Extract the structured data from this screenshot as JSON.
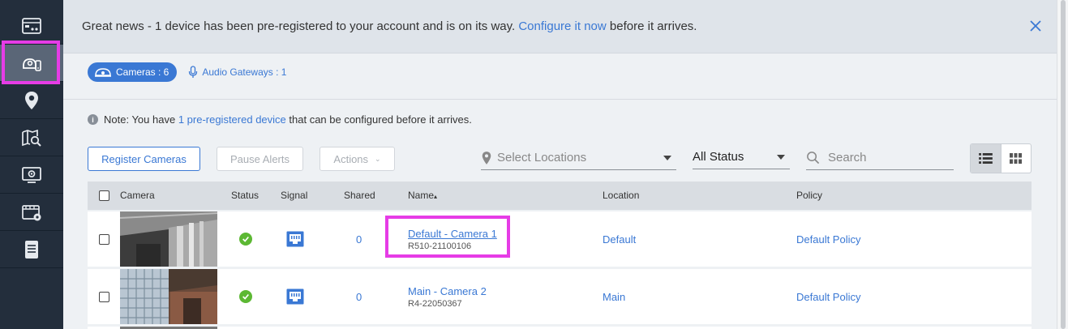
{
  "banner": {
    "text_before": "Great news - 1 device has been pre-registered to your account and is on its way. ",
    "link": "Configure it now",
    "text_after": " before it arrives."
  },
  "tabs": {
    "cameras": "Cameras : 6",
    "audio": "Audio Gateways : 1"
  },
  "note": {
    "prefix": "Note: You have ",
    "link": "1 pre-registered device",
    "suffix": " that can be configured before it arrives."
  },
  "toolbar": {
    "register": "Register Cameras",
    "pause": "Pause Alerts",
    "actions": "Actions",
    "locations_placeholder": "Select Locations",
    "status_value": "All Status",
    "search_placeholder": "Search"
  },
  "table": {
    "headers": {
      "camera": "Camera",
      "status": "Status",
      "signal": "Signal",
      "shared": "Shared",
      "name": "Name",
      "name_sort": "▴",
      "location": "Location",
      "policy": "Policy"
    },
    "rows": [
      {
        "shared": "0",
        "name": "Default - Camera 1",
        "serial": "R510-21100106",
        "location": "Default",
        "policy": "Default Policy"
      },
      {
        "shared": "0",
        "name": "Main - Camera 2",
        "serial": "R4-22050367",
        "location": "Main",
        "policy": "Default Policy"
      }
    ]
  },
  "colors": {
    "accent": "#3a78d4",
    "sidebar": "#232e3c",
    "highlight": "#e63ce6",
    "status_ok": "#5cb833"
  }
}
